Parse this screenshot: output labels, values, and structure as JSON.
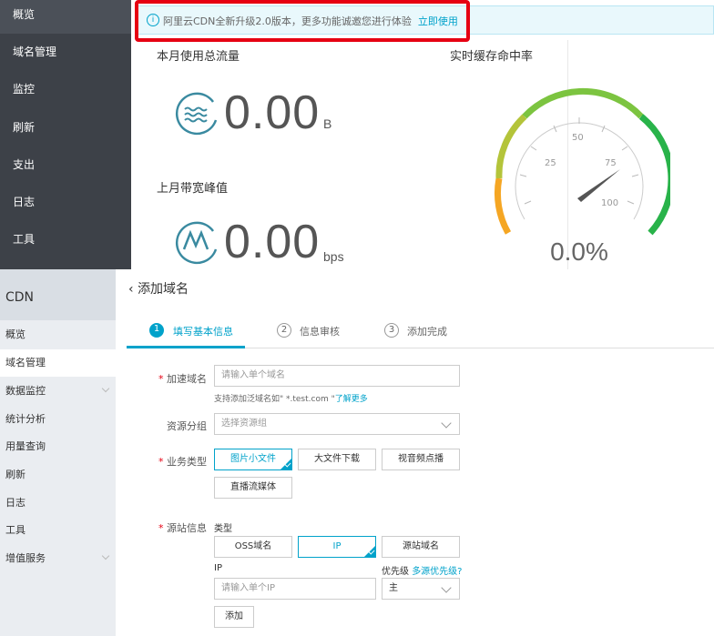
{
  "top_nav": {
    "items": [
      "概览",
      "域名管理",
      "监控",
      "刷新",
      "支出",
      "日志",
      "工具"
    ]
  },
  "banner": {
    "text": "阿里云CDN全新升级2.0版本，更多功能诚邀您进行体验",
    "link": "立即使用"
  },
  "traffic": {
    "title": "本月使用总流量",
    "value": "0.00",
    "unit": "B"
  },
  "bandwidth": {
    "title": "上月带宽峰值",
    "value": "0.00",
    "unit": "bps"
  },
  "cache": {
    "title": "实时缓存命中率",
    "value": "0.0%",
    "ticks": [
      "25",
      "50",
      "75",
      "100"
    ],
    "level": 0.0
  },
  "side_nav": {
    "header": "CDN",
    "items": [
      "概览",
      "域名管理",
      "数据监控",
      "统计分析",
      "用量查询",
      "刷新",
      "日志",
      "工具",
      "增值服务"
    ]
  },
  "page": {
    "back_title": "添加域名"
  },
  "steps": [
    {
      "num": "1",
      "label": "填写基本信息"
    },
    {
      "num": "2",
      "label": "信息审核"
    },
    {
      "num": "3",
      "label": "添加完成"
    }
  ],
  "form": {
    "domain_label": "加速域名",
    "domain_placeholder": "请输入单个域名",
    "domain_hint": "支持添加泛域名如\" *.test.com \"",
    "domain_hint_link": "了解更多",
    "group_label": "资源分组",
    "group_placeholder": "选择资源组",
    "biz_label": "业务类型",
    "biz_options": [
      "图片小文件",
      "大文件下载",
      "视音频点播",
      "直播流媒体"
    ],
    "origin_label": "源站信息",
    "type_label": "类型",
    "origin_types": [
      "OSS域名",
      "IP",
      "源站域名"
    ],
    "ip_label": "IP",
    "priority_label": "优先级",
    "priority_link": "多源优先级?",
    "ip_placeholder": "请输入单个IP",
    "priority_value": "主",
    "add_button": "添加"
  }
}
